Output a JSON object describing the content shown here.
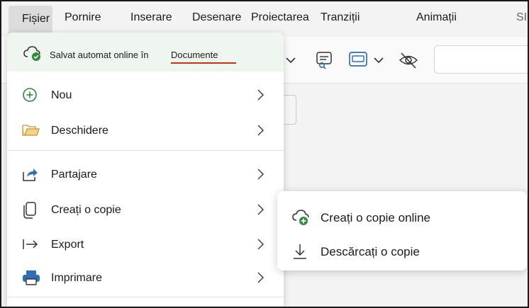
{
  "ribbon": {
    "tabs": [
      "Fișier",
      "Pornire",
      "Inserare",
      "Desenare",
      "Proiectarea",
      "Tranziții",
      "Animații",
      "SI"
    ]
  },
  "file_menu": {
    "autosave_text": "Salvat automat online în",
    "autosave_location": "Documente",
    "items": [
      {
        "label": "Nou",
        "icon": "plus-circle-icon"
      },
      {
        "label": "Deschidere",
        "icon": "folder-icon"
      },
      {
        "label": "Partajare",
        "icon": "share-icon"
      },
      {
        "label": "Creați o copie",
        "icon": "copy-icon"
      },
      {
        "label": "Export",
        "icon": "export-icon"
      },
      {
        "label": "Imprimare",
        "icon": "printer-icon"
      }
    ]
  },
  "submenu": {
    "items": [
      {
        "label": "Creați o copie online",
        "icon": "cloud-add-icon"
      },
      {
        "label": "Descărcați o copie",
        "icon": "download-icon"
      }
    ]
  },
  "colors": {
    "accent_green": "#2e8b3e",
    "autosave_bg": "#eef6ef",
    "link_underline": "#c4321a",
    "toolbar_blue": "#2f6fb3"
  }
}
